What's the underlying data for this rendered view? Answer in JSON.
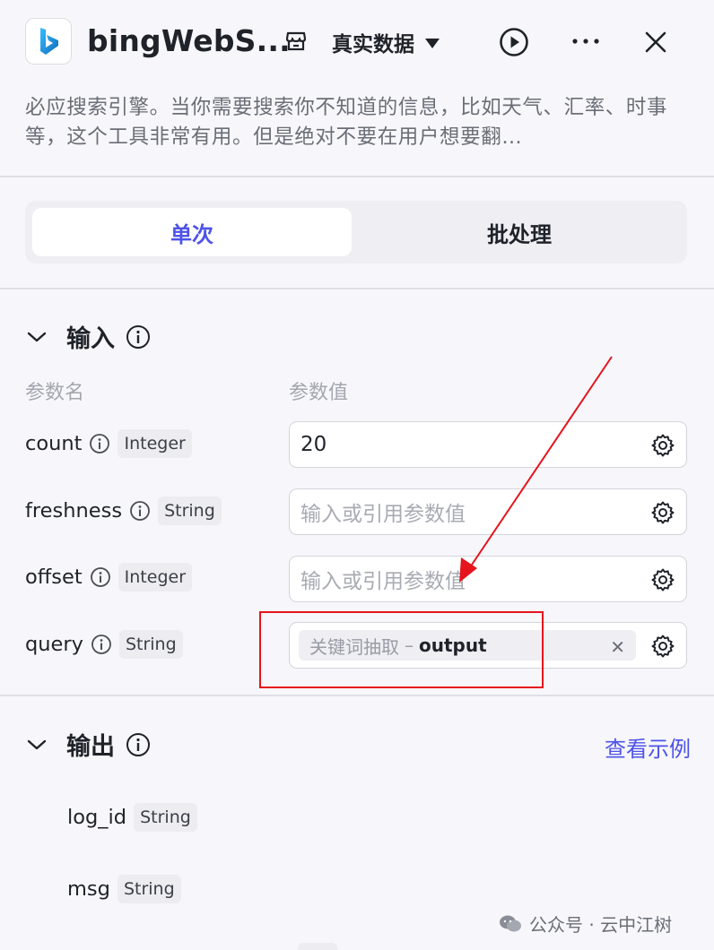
{
  "header": {
    "title": "bingWebS...",
    "mode_label": "真实数据",
    "logo_letter": "b",
    "brand_color": "#0f6cbd"
  },
  "description": "必应搜索引擎。当你需要搜索你不知道的信息，比如天气、汇率、时事等，这个工具非常有用。但是绝对不要在用户想要翻…",
  "tabs": {
    "single": "单次",
    "batch": "批处理",
    "active": "单次"
  },
  "input_section": {
    "title": "输入",
    "col_name": "参数名",
    "col_value": "参数值",
    "params": [
      {
        "name": "count",
        "type": "Integer",
        "value": "20",
        "placeholder": ""
      },
      {
        "name": "freshness",
        "type": "String",
        "value": "",
        "placeholder": "输入或引用参数值"
      },
      {
        "name": "offset",
        "type": "Integer",
        "value": "",
        "placeholder": "输入或引用参数值"
      },
      {
        "name": "query",
        "type": "String",
        "ref_source": "关键词抽取",
        "ref_separator": "–",
        "ref_output": "output"
      }
    ]
  },
  "output_section": {
    "title": "输出",
    "example_link": "查看示例",
    "fields": [
      {
        "name": "log_id",
        "type": "String"
      },
      {
        "name": "msg",
        "type": "String"
      }
    ]
  },
  "watermark": "公众号 · 云中江树",
  "colors": {
    "accent": "#4d53e8",
    "annotation": "#e5141d"
  }
}
